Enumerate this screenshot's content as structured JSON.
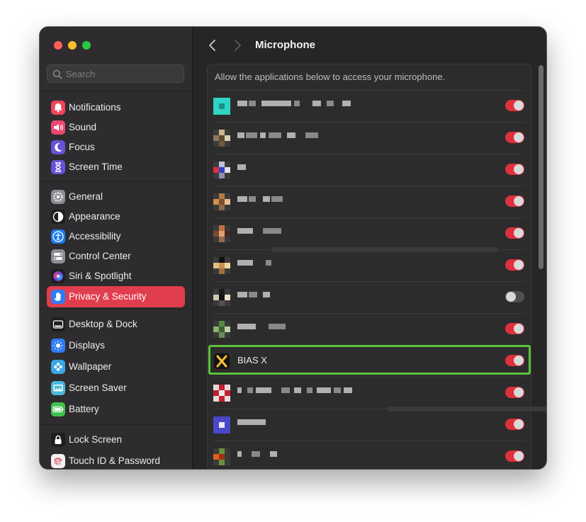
{
  "window": {
    "traffic_lights": {
      "close": "#fe5f57",
      "minimize": "#febc2e",
      "zoom": "#28c840"
    }
  },
  "sidebar": {
    "search": {
      "placeholder": "Search"
    },
    "groups": [
      [
        {
          "label": "Notifications",
          "icon": "bell-icon",
          "color": "#f0455a"
        },
        {
          "label": "Sound",
          "icon": "speaker-icon",
          "color": "#ef4670"
        },
        {
          "label": "Focus",
          "icon": "moon-icon",
          "color": "#6553d8"
        },
        {
          "label": "Screen Time",
          "icon": "hourglass-icon",
          "color": "#6553d8"
        }
      ],
      [
        {
          "label": "General",
          "icon": "gear-icon",
          "color": "#8f8f93"
        },
        {
          "label": "Appearance",
          "icon": "appearance-icon",
          "color": "#1e1e1e"
        },
        {
          "label": "Accessibility",
          "icon": "accessibility-icon",
          "color": "#1c7cf0"
        },
        {
          "label": "Control Center",
          "icon": "toggles-icon",
          "color": "#8f8f93"
        },
        {
          "label": "Siri & Spotlight",
          "icon": "siri-icon",
          "color": "#1e1e1e"
        },
        {
          "label": "Privacy & Security",
          "icon": "hand-icon",
          "color": "#2f7bf5",
          "selected": true
        }
      ],
      [
        {
          "label": "Desktop & Dock",
          "icon": "dock-icon",
          "color": "#1e1e1e"
        },
        {
          "label": "Displays",
          "icon": "sun-icon",
          "color": "#2f7bf5"
        },
        {
          "label": "Wallpaper",
          "icon": "flower-icon",
          "color": "#3aa6e8"
        },
        {
          "label": "Screen Saver",
          "icon": "screensaver-icon",
          "color": "#4cb8d8"
        },
        {
          "label": "Battery",
          "icon": "battery-icon",
          "color": "#3fc34e"
        }
      ],
      [
        {
          "label": "Lock Screen",
          "icon": "lock-icon",
          "color": "#1e1e1e"
        },
        {
          "label": "Touch ID & Password",
          "icon": "fingerprint-icon",
          "color": "#f2f2f2"
        }
      ]
    ]
  },
  "main": {
    "title": "Microphone",
    "header": "Allow the applications below to access your microphone.",
    "apps": [
      {
        "name": "",
        "enabled": true
      },
      {
        "name": "",
        "enabled": true
      },
      {
        "name": "",
        "enabled": true
      },
      {
        "name": "",
        "enabled": true
      },
      {
        "name": "",
        "enabled": true
      },
      {
        "name": "",
        "enabled": true
      },
      {
        "name": "",
        "enabled": false
      },
      {
        "name": "",
        "enabled": true
      },
      {
        "name": "BIAS X",
        "enabled": true,
        "highlighted": true
      },
      {
        "name": "",
        "enabled": true
      },
      {
        "name": "",
        "enabled": true
      },
      {
        "name": "",
        "enabled": true
      }
    ]
  },
  "colors": {
    "accent": "#e03e4e",
    "toggle_on": "#e0303d",
    "highlight": "#5cc23b"
  }
}
